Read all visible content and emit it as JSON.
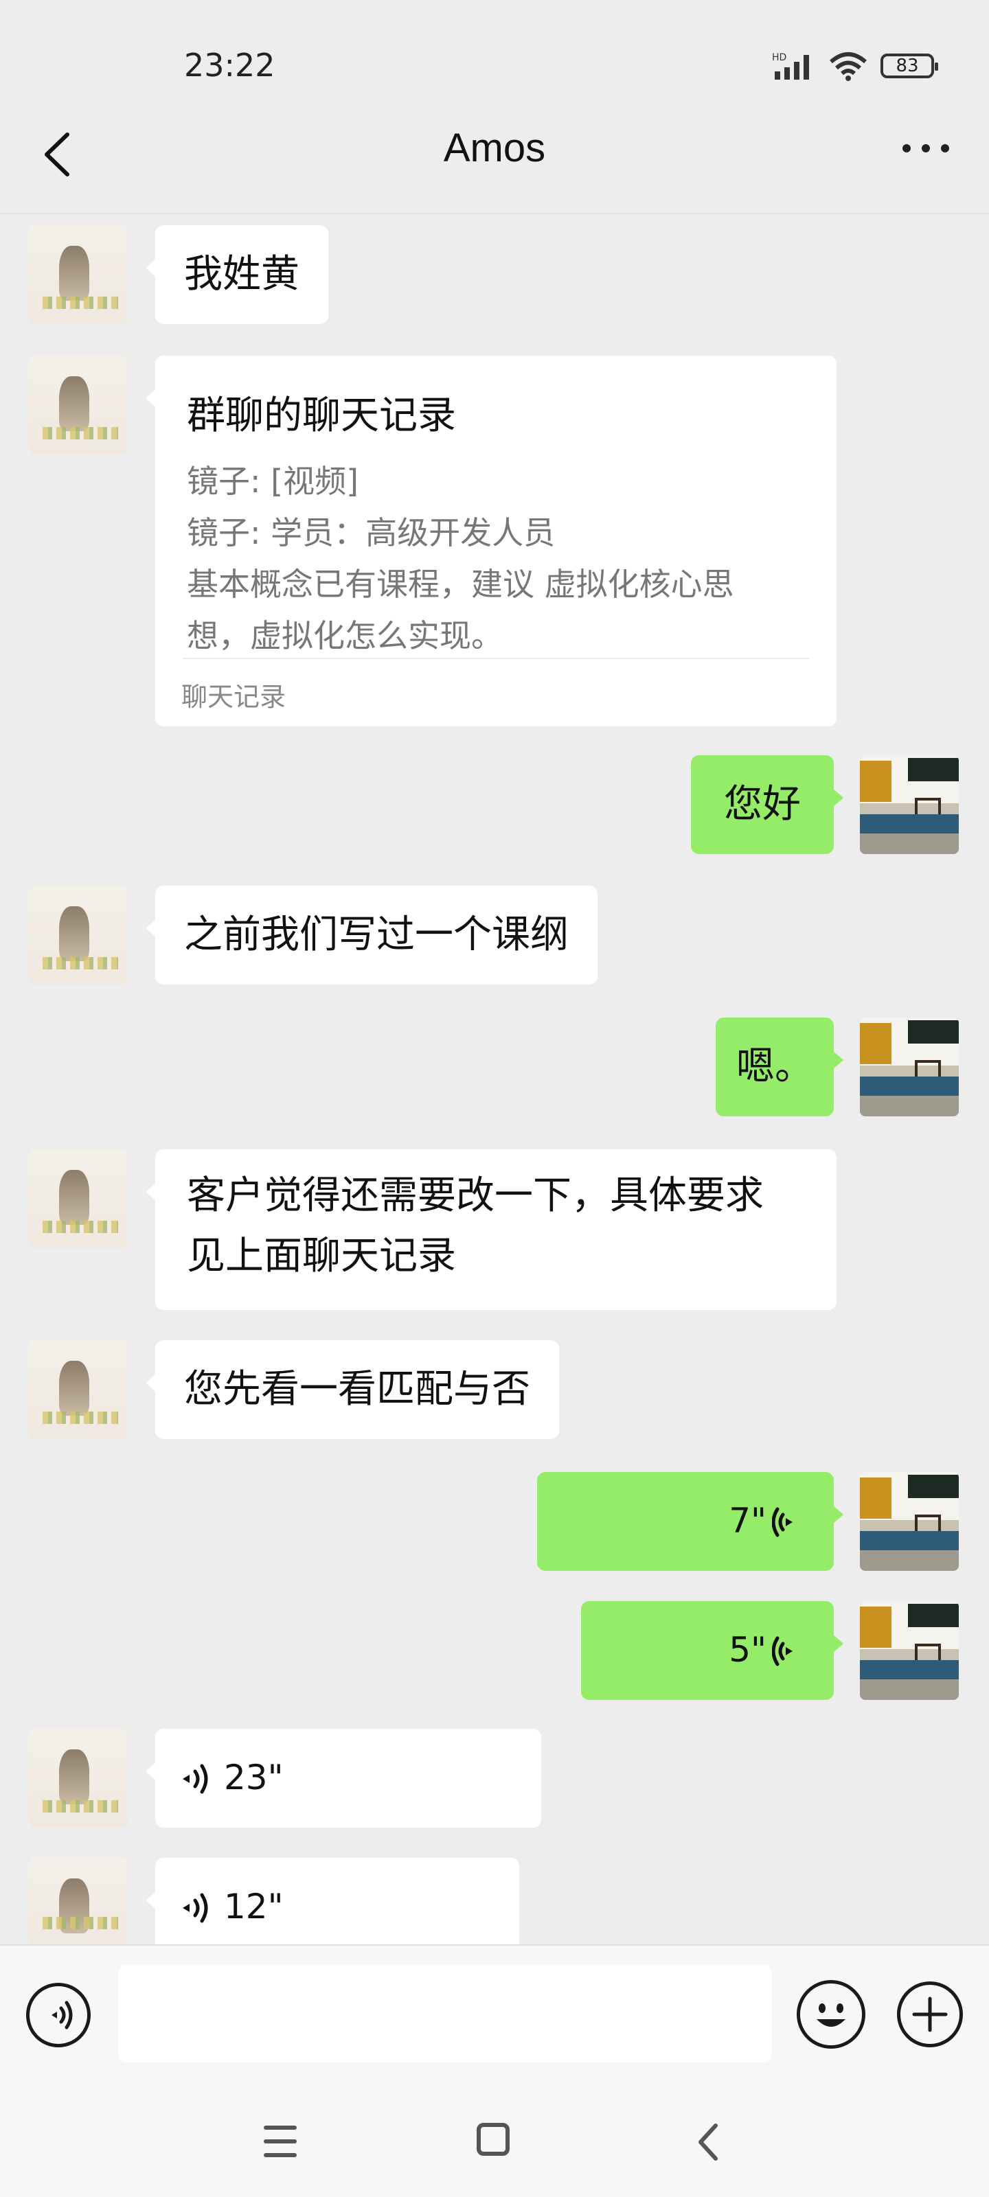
{
  "status_bar": {
    "time": "23:22",
    "signal_label": "HD",
    "battery": "83"
  },
  "header": {
    "title": "Amos"
  },
  "messages": [
    {
      "side": "left",
      "type": "text",
      "text": "我姓黄"
    },
    {
      "side": "left",
      "type": "chat_record",
      "title": "群聊的聊天记录",
      "lines": [
        "镜子: [视频]",
        "镜子: 学员：高级开发人员",
        "基本概念已有课程，建议 虚拟化核心思",
        "想，虚拟化怎么实现。"
      ],
      "footer": "聊天记录"
    },
    {
      "side": "right",
      "type": "text",
      "text": "您好"
    },
    {
      "side": "left",
      "type": "text",
      "text": "之前我们写过一个课纲"
    },
    {
      "side": "right",
      "type": "text",
      "text": "嗯。"
    },
    {
      "side": "left",
      "type": "text",
      "lines": [
        "客户觉得还需要改一下，具体要求",
        "见上面聊天记录"
      ]
    },
    {
      "side": "left",
      "type": "text",
      "text": "您先看一看匹配与否"
    },
    {
      "side": "right",
      "type": "voice",
      "duration": "7\""
    },
    {
      "side": "right",
      "type": "voice",
      "duration": "5\""
    },
    {
      "side": "left",
      "type": "voice",
      "duration": "23\""
    },
    {
      "side": "left",
      "type": "voice",
      "duration": "12\""
    }
  ],
  "input_bar": {
    "value": ""
  },
  "icons": {
    "back": "back-chevron-icon",
    "more": "more-dots-icon",
    "voice": "voice-input-icon",
    "emoji": "emoji-icon",
    "plus": "plus-icon",
    "nav_menu": "menu-icon",
    "nav_home": "home-icon",
    "nav_back": "back-icon"
  },
  "colors": {
    "background": "#ededed",
    "outgoing_bubble": "#95ec69",
    "incoming_bubble": "#ffffff"
  }
}
